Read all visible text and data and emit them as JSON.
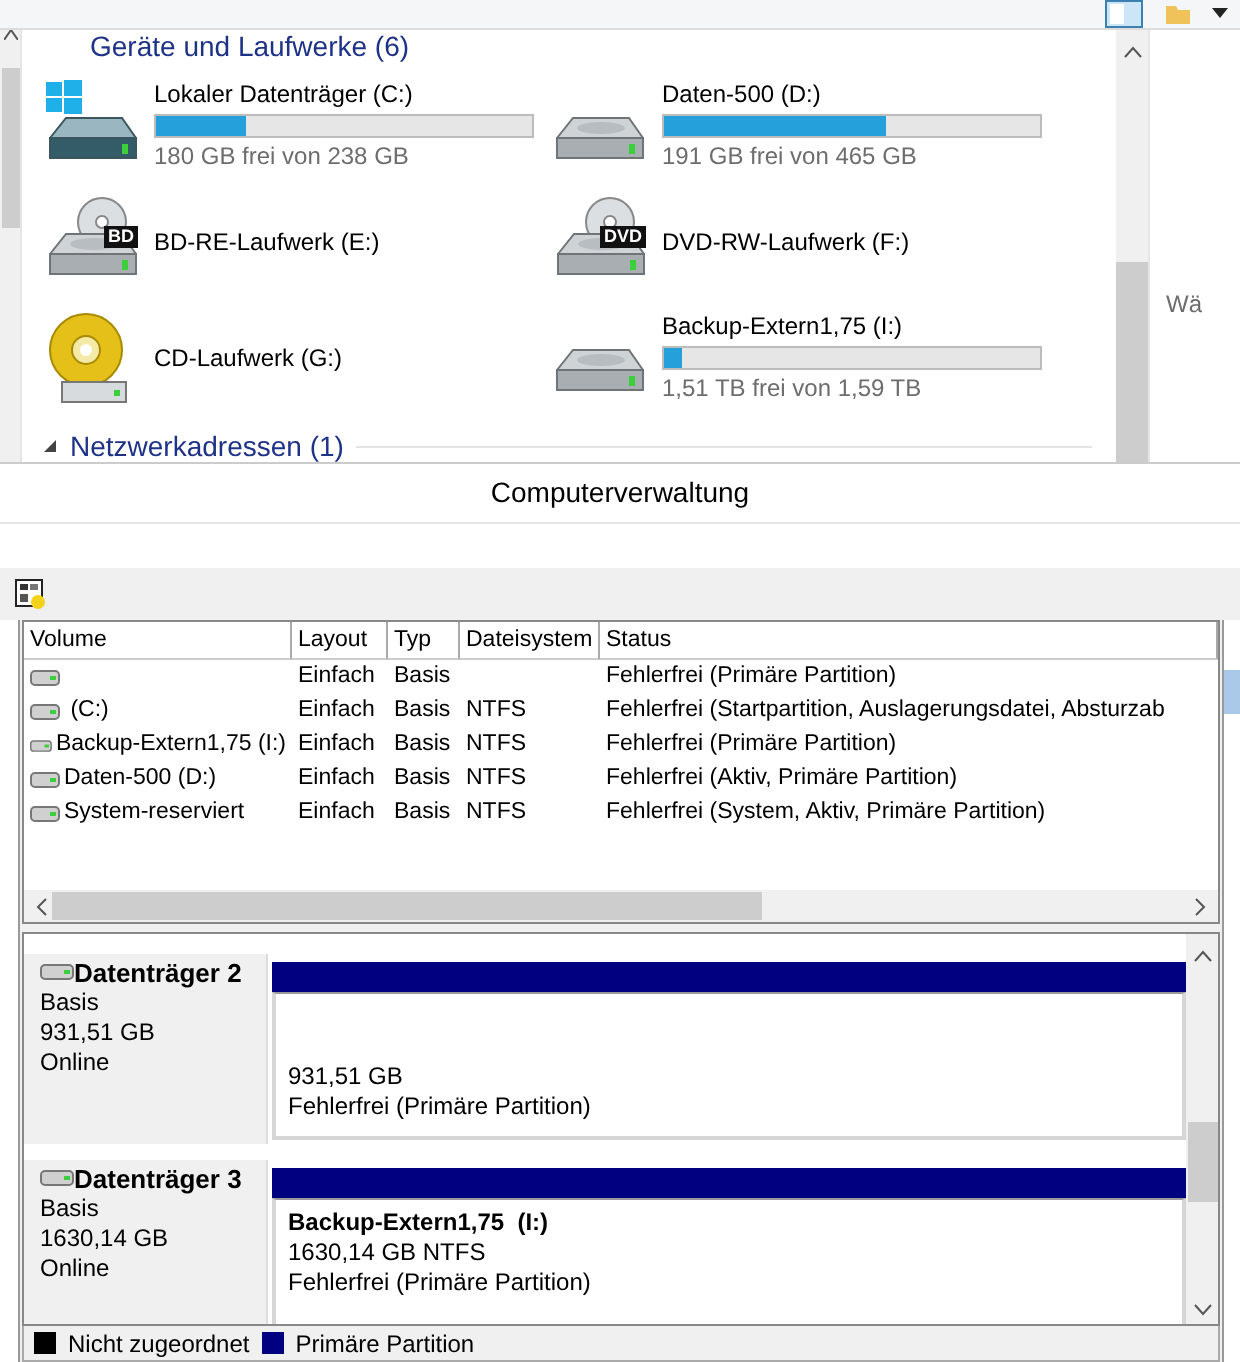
{
  "explorer": {
    "group_header": "Geräte und Laufwerke (6)",
    "drives": [
      {
        "kind": "windows-disk",
        "name": "Lokaler Datenträger (C:)",
        "level": 0.24,
        "free": "180 GB frei von 238 GB"
      },
      {
        "kind": "disk",
        "name": "Daten-500 (D:)",
        "level": 0.59,
        "free": "191 GB frei von 465 GB"
      },
      {
        "kind": "bd",
        "name": "BD-RE-Laufwerk (E:)",
        "badge": "BD"
      },
      {
        "kind": "dvd",
        "name": "DVD-RW-Laufwerk (F:)",
        "badge": "DVD"
      },
      {
        "kind": "cd",
        "name": "CD-Laufwerk (G:)"
      },
      {
        "kind": "disk",
        "name": "Backup-Extern1,75 (I:)",
        "level": 0.05,
        "free": "1,51 TB frei von 1,59 TB"
      }
    ],
    "network_header": "Netzwerkadressen (1)",
    "preview_pane_text": "Wä"
  },
  "window": {
    "title": "Computerverwaltung"
  },
  "volume_table": {
    "columns": [
      "Volume",
      "Layout",
      "Typ",
      "Dateisystem",
      "Status"
    ],
    "rows": [
      [
        "",
        "Einfach",
        "Basis",
        "",
        "Fehlerfrei (Primäre Partition)"
      ],
      [
        " (C:)",
        "Einfach",
        "Basis",
        "NTFS",
        "Fehlerfrei (Startpartition, Auslagerungsdatei, Absturzab"
      ],
      [
        "Backup-Extern1,75 (I:)",
        "Einfach",
        "Basis",
        "NTFS",
        "Fehlerfrei (Primäre Partition)"
      ],
      [
        "Daten-500 (D:)",
        "Einfach",
        "Basis",
        "NTFS",
        "Fehlerfrei (Aktiv, Primäre Partition)"
      ],
      [
        "System-reserviert",
        "Einfach",
        "Basis",
        "NTFS",
        "Fehlerfrei (System, Aktiv, Primäre Partition)"
      ]
    ]
  },
  "disks": [
    {
      "name": "Datenträger 2",
      "type": "Basis",
      "size": "931,51 GB",
      "state": "Online",
      "partition": {
        "color": "#000080",
        "lines": [
          "931,51 GB",
          "Fehlerfrei (Primäre Partition)"
        ]
      }
    },
    {
      "name": "Datenträger 3",
      "type": "Basis",
      "size": "1630,14 GB",
      "state": "Online",
      "partition": {
        "color": "#000080",
        "title": "Backup-Extern1,75  (I:)",
        "lines": [
          "1630,14 GB NTFS",
          "Fehlerfrei (Primäre Partition)"
        ]
      }
    }
  ],
  "legend": [
    {
      "label": "Nicht zugeordnet",
      "color": "#000000"
    },
    {
      "label": "Primäre Partition",
      "color": "#000080"
    }
  ]
}
